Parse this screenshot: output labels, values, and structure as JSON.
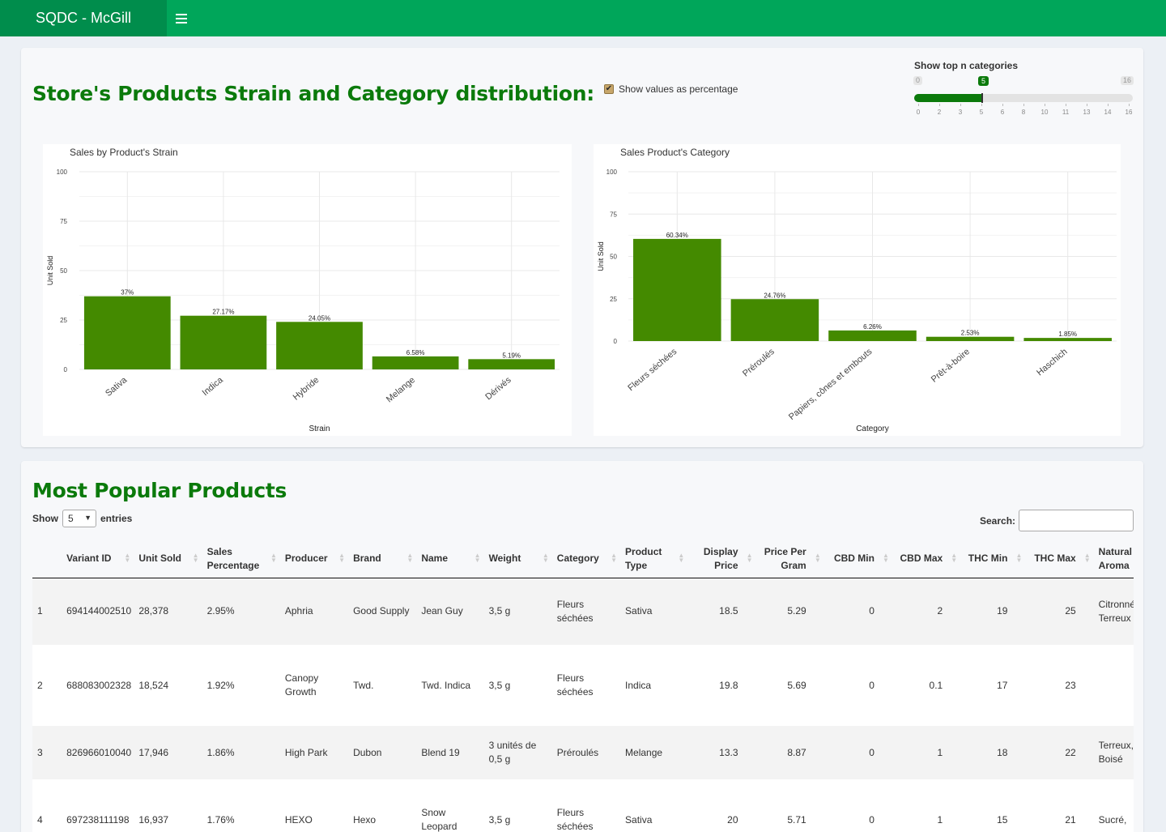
{
  "header": {
    "title": "SQDC - McGill"
  },
  "distribution": {
    "title": "Store's Products Strain and Category distribution:",
    "checkbox_label": "Show values as percentage",
    "checkbox_checked": true,
    "slider": {
      "label": "Show top n categories",
      "min": "0",
      "max": "16",
      "value": "5",
      "ticks": [
        "0",
        "2",
        "3",
        "5",
        "6",
        "8",
        "10",
        "11",
        "13",
        "14",
        "16"
      ]
    }
  },
  "chart_data": [
    {
      "type": "bar",
      "title": "Sales by Product's Strain",
      "xlabel": "Strain",
      "ylabel": "Unit Sold",
      "categories": [
        "Sativa",
        "Indica",
        "Hybride",
        "Melange",
        "Dérivés"
      ],
      "values": [
        37,
        27.17,
        24.05,
        6.58,
        5.19
      ],
      "labels": [
        "37%",
        "27.17%",
        "24.05%",
        "6.58%",
        "5.19%"
      ],
      "ylim": [
        0,
        100
      ],
      "yticks": [
        "0",
        "25",
        "50",
        "75",
        "100"
      ],
      "color": "#448a00"
    },
    {
      "type": "bar",
      "title": "Sales Product's Category",
      "xlabel": "Category",
      "ylabel": "Unit Sold",
      "categories": [
        "Fleurs séchées",
        "Préroulés",
        "Papiers, cônes et embouts",
        "Prêt-à-boire",
        "Haschich"
      ],
      "values": [
        60.34,
        24.76,
        6.26,
        2.53,
        1.85
      ],
      "labels": [
        "60.34%",
        "24.76%",
        "6.26%",
        "2.53%",
        "1.85%"
      ],
      "ylim": [
        0,
        100
      ],
      "yticks": [
        "0",
        "25",
        "50",
        "75",
        "100"
      ],
      "color": "#448a00"
    }
  ],
  "popular": {
    "title": "Most Popular Products",
    "show_label": "Show",
    "entries_value": "5",
    "entries_label": "entries",
    "search_label": "Search:",
    "columns": [
      "",
      "Variant ID",
      "Unit Sold",
      "Sales Percentage",
      "Producer",
      "Brand",
      "Name",
      "Weight",
      "Category",
      "Product Type",
      "Display Price",
      "Price Per Gram",
      "CBD Min",
      "CBD Max",
      "THC Min",
      "THC Max",
      "Natural Aroma"
    ],
    "rows": [
      [
        "1",
        "694144002510",
        "28,378",
        "2.95%",
        "Aphria",
        "Good Supply",
        "Jean Guy",
        "3,5 g",
        "Fleurs séchées",
        "Sativa",
        "18.5",
        "5.29",
        "0",
        "2",
        "19",
        "25",
        "Citronné, Terreux"
      ],
      [
        "2",
        "688083002328",
        "18,524",
        "1.92%",
        "Canopy Growth",
        "Twd.",
        "Twd. Indica",
        "3,5 g",
        "Fleurs séchées",
        "Indica",
        "19.8",
        "5.69",
        "0",
        "0.1",
        "17",
        "23",
        ""
      ],
      [
        "3",
        "826966010040",
        "17,946",
        "1.86%",
        "High Park",
        "Dubon",
        "Blend 19",
        "3 unités de 0,5 g",
        "Préroulés",
        "Melange",
        "13.3",
        "8.87",
        "0",
        "1",
        "18",
        "22",
        "Terreux, Boisé"
      ],
      [
        "4",
        "697238111198",
        "16,937",
        "1.76%",
        "HEXO",
        "Hexo",
        "Snow Leopard",
        "3,5 g",
        "Fleurs séchées",
        "Sativa",
        "20",
        "5.71",
        "0",
        "1",
        "15",
        "21",
        "Sucré,"
      ]
    ]
  }
}
